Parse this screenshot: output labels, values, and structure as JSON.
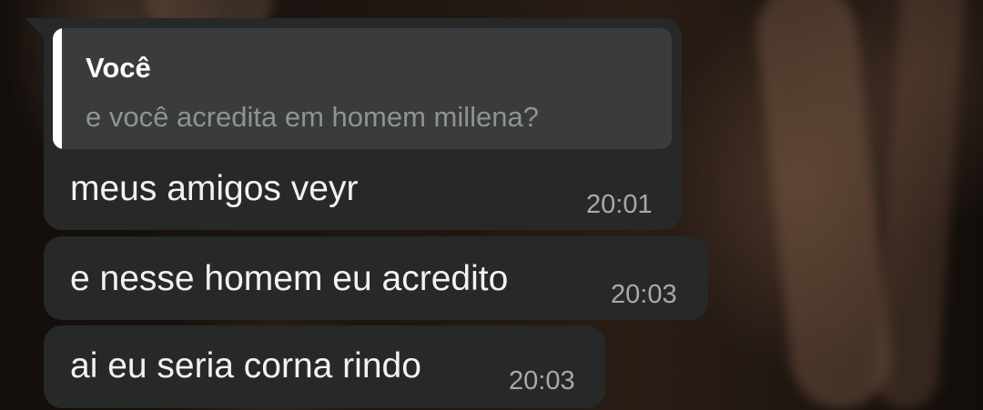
{
  "reply": {
    "author": "Você",
    "quoted_text": "e você acredita em homem millena?"
  },
  "messages": [
    {
      "text": "meus amigos veyr",
      "time": "20:01"
    },
    {
      "text": "e nesse homem eu acredito",
      "time": "20:03"
    },
    {
      "text": "ai eu seria corna rindo",
      "time": "20:03"
    }
  ],
  "colors": {
    "bubble": "#272828",
    "quote_background": "#3a3b3c",
    "quote_bar": "#ffffff",
    "message_text": "#f2f2f2",
    "time_text": "#a7a9aa"
  }
}
